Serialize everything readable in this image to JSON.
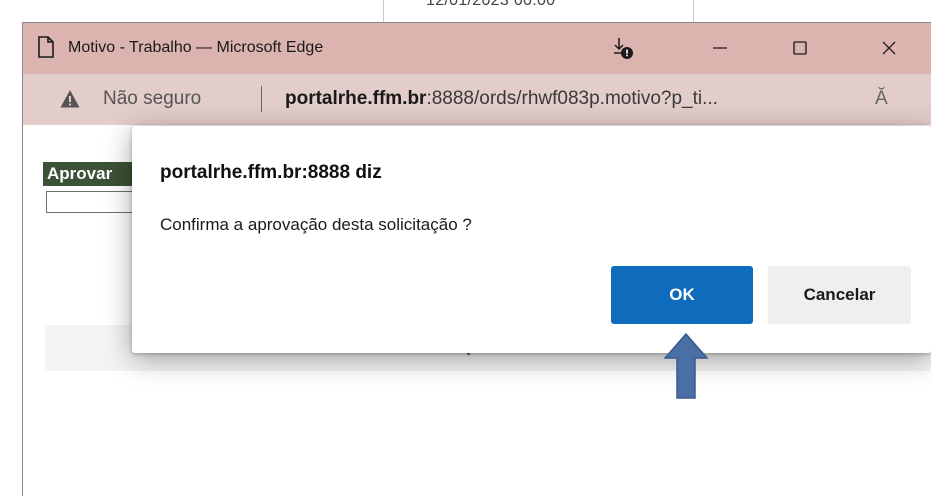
{
  "background": {
    "date_fragment": "12/01/2023 00:00"
  },
  "window": {
    "title": "Motivo - Trabalho — Microsoft Edge",
    "icons": [
      "page-icon",
      "download-alert-icon",
      "minimize-icon",
      "maximize-icon",
      "close-icon"
    ]
  },
  "addressbar": {
    "security_text": "Não seguro",
    "url_host": "portalrhe.ffm.br",
    "url_rest": ":8888/ords/rhwf083p.motivo?p_ti...",
    "read_aloud": "Ă"
  },
  "page": {
    "label": "Aprovar",
    "motive_value": ""
  },
  "dialog": {
    "origin": "portalrhe.ffm.br:8888 diz",
    "message": "Confirma a aprovação desta solicitação ?",
    "ok_label": "OK",
    "cancel_label": "Cancelar"
  },
  "colors": {
    "titlebar": "#dbb4b0",
    "addressbar": "#e3cdca",
    "ok_button": "#0f6cbd",
    "annotation_arrow": "#4a6fa5",
    "label_bg": "#3c5236"
  }
}
